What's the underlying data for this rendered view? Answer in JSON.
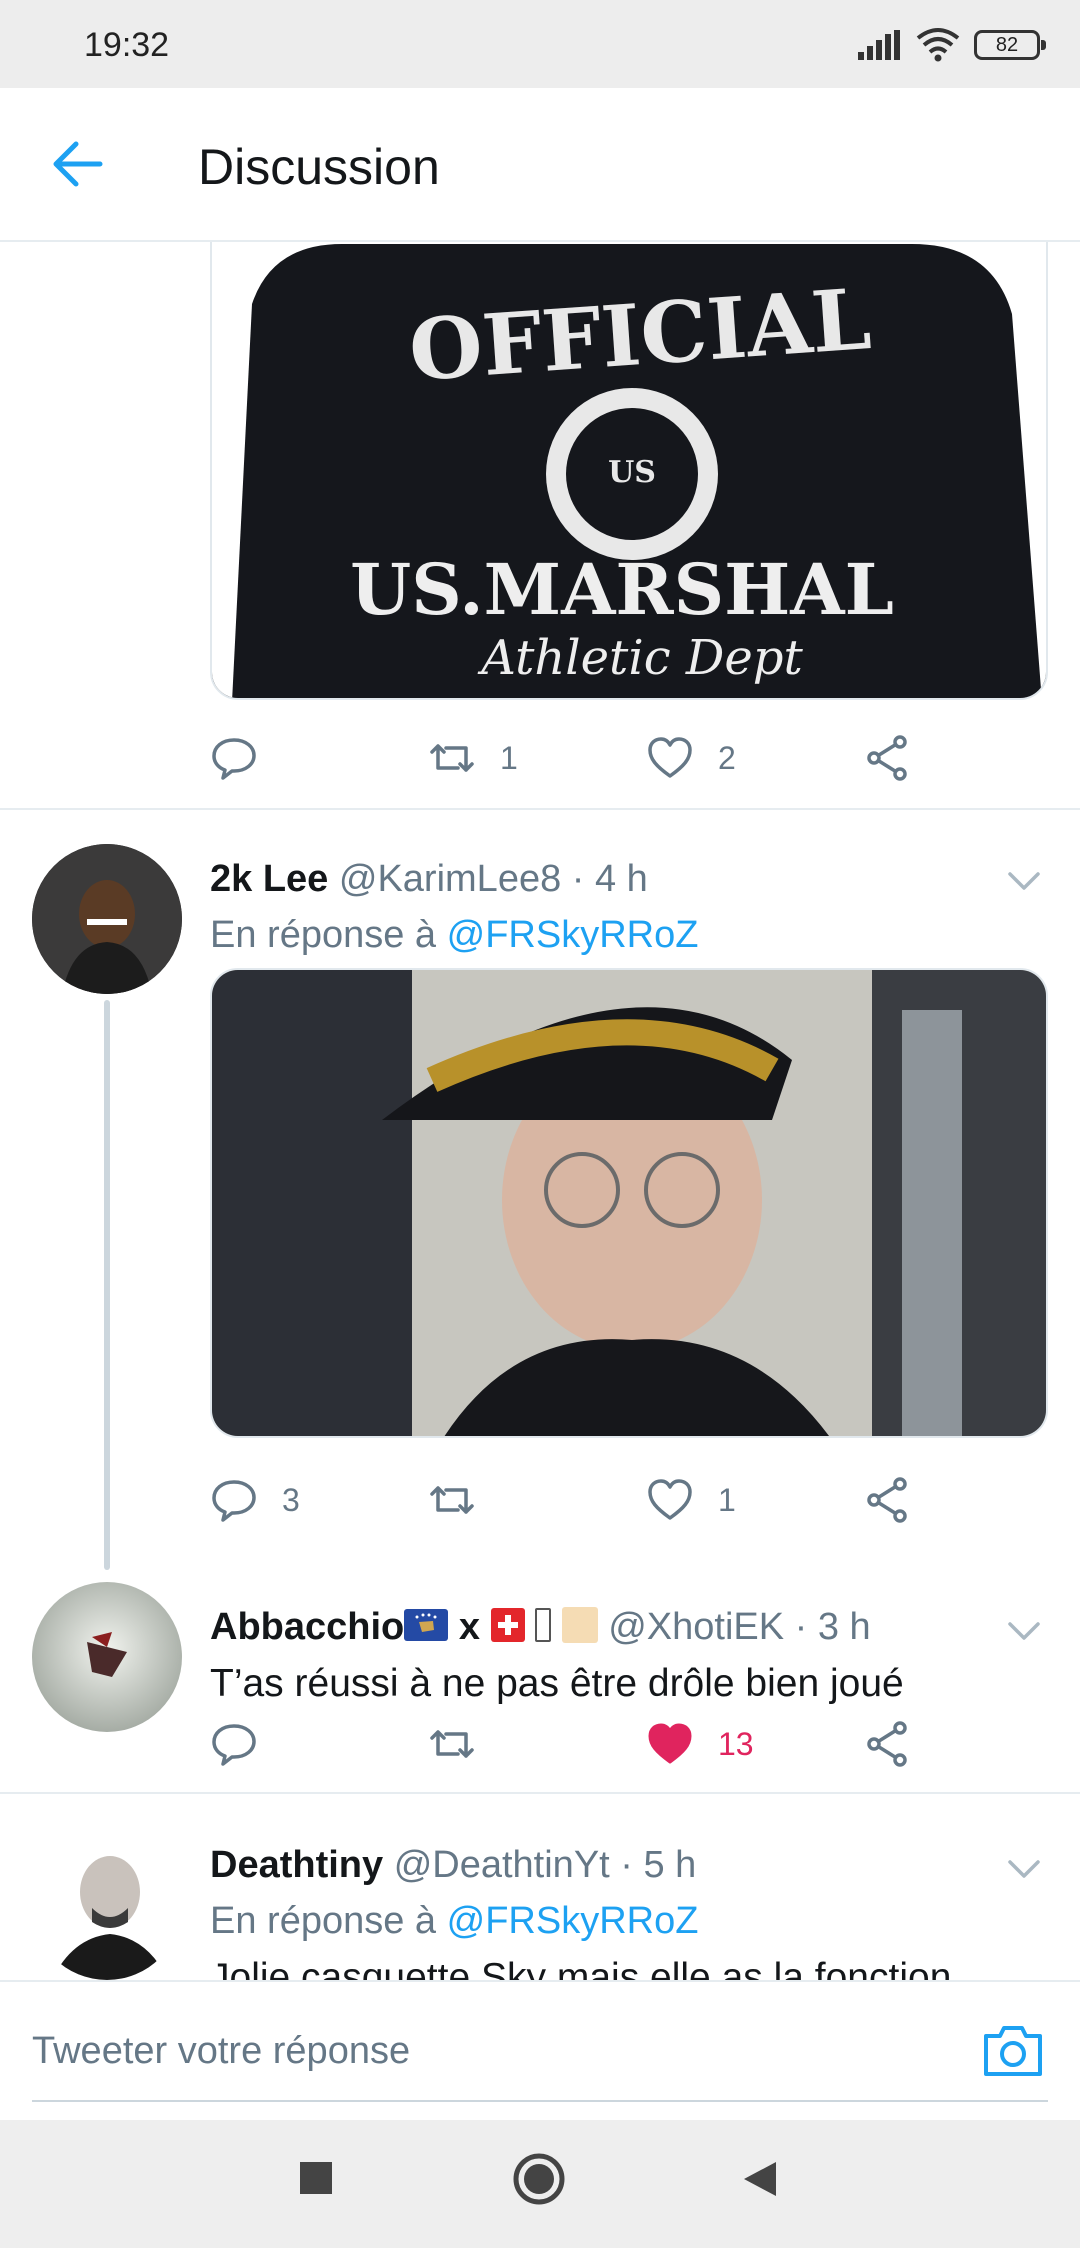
{
  "status_bar": {
    "time": "19:32",
    "battery": "82"
  },
  "header": {
    "title": "Discussion"
  },
  "tweets": [
    {
      "media_caption": "Image du tweet : sweat noir OFFICIAL US.MARSHAL Athletic Dept",
      "actions": {
        "reply": "",
        "retweet": "1",
        "like": "2"
      }
    },
    {
      "name": "2k Lee",
      "handle": "@KarimLee8",
      "time": "· 4 h",
      "reply_prefix": "En réponse à",
      "reply_to": "@FRSkyRRoZ",
      "actions": {
        "reply": "3",
        "retweet": "",
        "like": "1"
      }
    },
    {
      "name": "Abbacchio",
      "name_mid": "x",
      "handle": "@XhotiEK",
      "time": "· 3 h",
      "text": "T’as réussi à ne pas être drôle bien joué",
      "actions": {
        "reply": "",
        "retweet": "",
        "like": "13",
        "liked": true
      }
    },
    {
      "name": "Deathtiny",
      "handle": "@DeathtinYt",
      "time": "· 5 h",
      "reply_prefix": "En réponse à",
      "reply_to": "@FRSkyRRoZ",
      "text": "Jolie casquette Sky mais elle as la fonction"
    }
  ],
  "compose": {
    "placeholder": "Tweeter votre réponse"
  },
  "colors": {
    "accent": "#1da1f2",
    "like": "#e0245e",
    "muted": "#657786"
  }
}
